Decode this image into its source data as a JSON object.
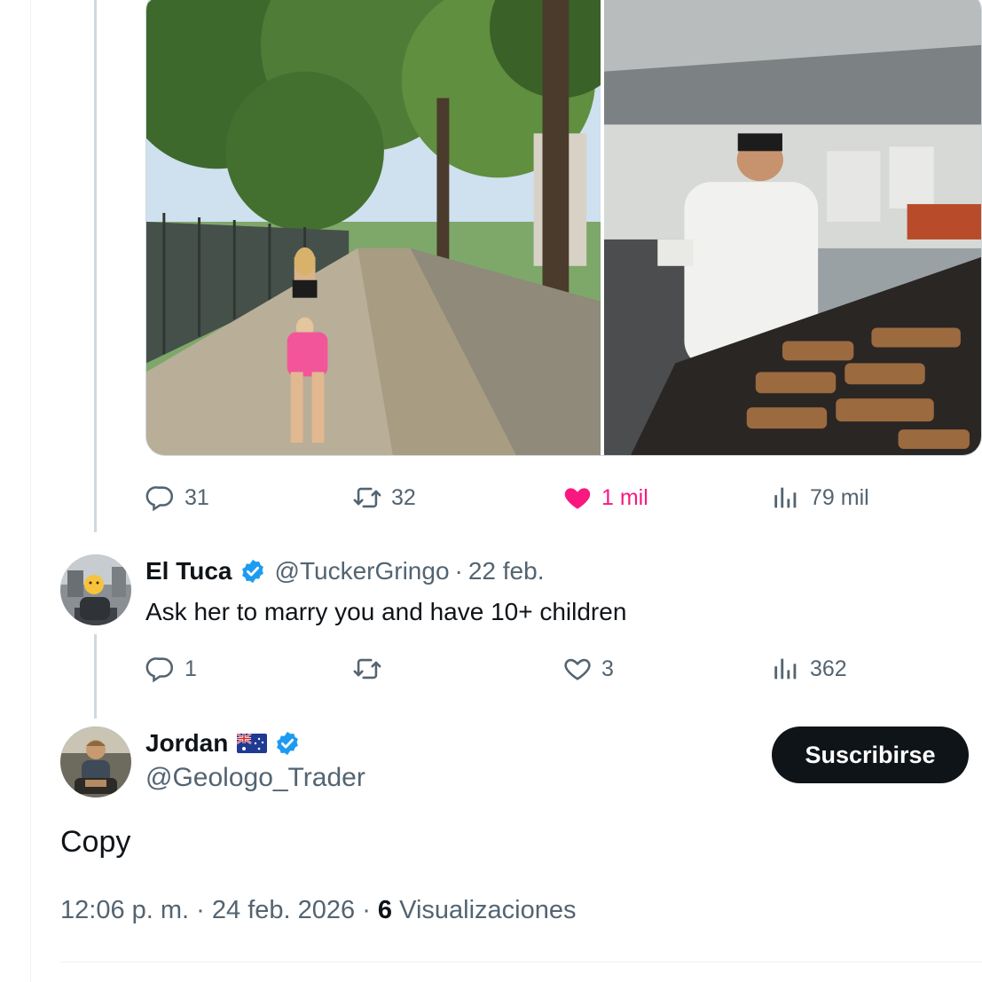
{
  "post": {
    "actions": {
      "replies": "31",
      "reposts": "32",
      "likes": "1 mil",
      "views": "79 mil"
    }
  },
  "reply1": {
    "name": "El Tuca",
    "handle": "@TuckerGringo",
    "date": "22 feb.",
    "text": "Ask her to marry you and have 10+ children",
    "actions": {
      "replies": "1",
      "reposts": "",
      "likes": "3",
      "views": "362"
    }
  },
  "reply2": {
    "name": "Jordan",
    "handle": "@Geologo_Trader",
    "text": "Copy",
    "subscribe_label": "Suscribirse",
    "time": "12:06 p. m.",
    "date": "24 feb. 2026",
    "views_count": "6",
    "views_label": "Visualizaciones"
  },
  "colors": {
    "like_active": "#f91880",
    "verified": "#1d9bf0",
    "muted": "#536471"
  }
}
